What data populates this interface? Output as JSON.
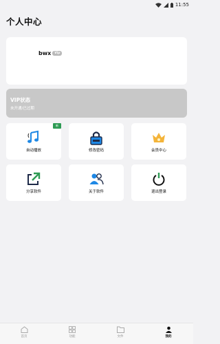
{
  "status_bar": {
    "time": "11:55"
  },
  "page": {
    "title": "个人中心"
  },
  "profile": {
    "logo_text": "bwx",
    "logo_badge": "Vip"
  },
  "vip": {
    "title": "VIP状态",
    "status": "未开通/已过期"
  },
  "grid": [
    {
      "label": "自动播放",
      "badge": "新",
      "icon": "music-note-icon"
    },
    {
      "label": "修改密码",
      "icon": "lock-icon"
    },
    {
      "label": "会员中心",
      "icon": "crown-icon"
    },
    {
      "label": "分享软件",
      "icon": "share-icon"
    },
    {
      "label": "关于软件",
      "icon": "users-icon"
    },
    {
      "label": "退出登录",
      "icon": "power-icon"
    }
  ],
  "bottom_nav": [
    {
      "label": "首页",
      "icon": "home-icon"
    },
    {
      "label": "功能",
      "icon": "grid-icon"
    },
    {
      "label": "文件",
      "icon": "folder-icon"
    },
    {
      "label": "我的",
      "icon": "person-icon",
      "active": true
    }
  ],
  "colors": {
    "accent_blue": "#1e88e5",
    "accent_green": "#2e9b54",
    "vip_bg": "#c8c8c8",
    "crown_gold": "#f4b43a"
  }
}
